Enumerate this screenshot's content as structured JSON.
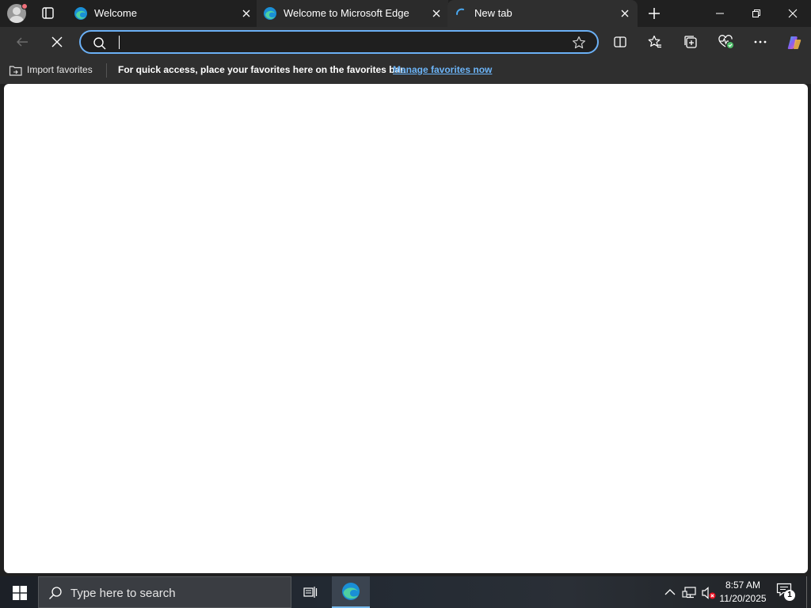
{
  "browser": {
    "tabs": [
      {
        "title": "Welcome"
      },
      {
        "title": "Welcome to Microsoft Edge"
      },
      {
        "title": "New tab"
      }
    ],
    "address": {
      "value": "",
      "placeholder": ""
    },
    "favorites_bar": {
      "import_label": "Import favorites",
      "message": "For quick access, place your favorites here on the favorites bar.",
      "manage_link": "Manage favorites now"
    }
  },
  "taskbar": {
    "search_placeholder": "Type here to search",
    "time": "8:57 AM",
    "date": "11/20/2025",
    "notification_count": "1"
  },
  "colors": {
    "accent": "#6bb0f5",
    "link": "#6cb4f7",
    "chrome_dark": "#202020",
    "toolbar": "#2f2f2f"
  },
  "icons": [
    "profile-icon",
    "tab-actions-icon",
    "edge-icon",
    "loading-spinner-icon",
    "close-icon",
    "plus-icon",
    "minimize-icon",
    "restore-icon",
    "back-arrow-icon",
    "stop-icon",
    "search-icon",
    "star-icon",
    "split-screen-icon",
    "favorites-icon",
    "collections-icon",
    "browser-essentials-icon",
    "more-icon",
    "copilot-icon",
    "windows-logo-icon",
    "task-view-icon",
    "chevron-up-icon",
    "network-icon",
    "volume-muted-icon",
    "notification-icon"
  ]
}
